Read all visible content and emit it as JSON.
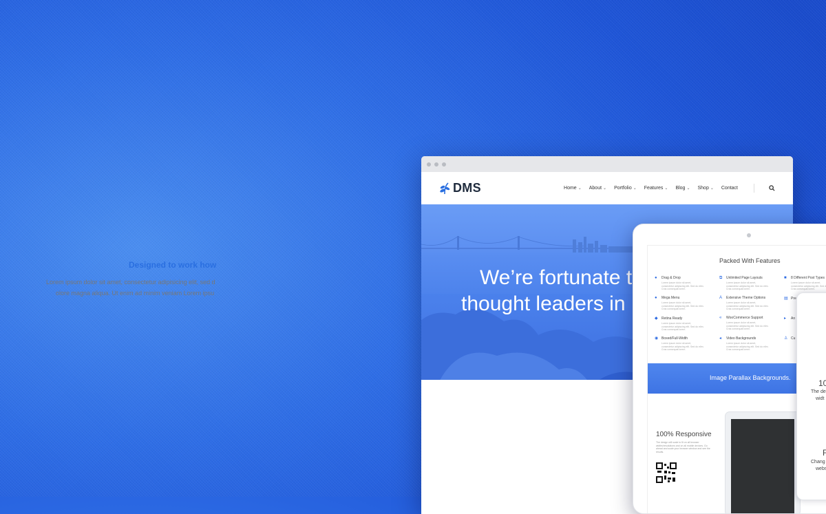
{
  "colors": {
    "accent": "#2a6fe0",
    "background": "#2f6ee6",
    "dark_text": "#1f2b3d"
  },
  "site": {
    "logo_text": "DMS",
    "logo_icon": "leaf-icon",
    "menu": [
      {
        "label": "Home",
        "has_dropdown": true
      },
      {
        "label": "About",
        "has_dropdown": true
      },
      {
        "label": "Portfolio",
        "has_dropdown": true
      },
      {
        "label": "Features",
        "has_dropdown": true
      },
      {
        "label": "Blog",
        "has_dropdown": true
      },
      {
        "label": "Shop",
        "has_dropdown": true
      },
      {
        "label": "Contact",
        "has_dropdown": false
      }
    ],
    "search_icon": "search-icon"
  },
  "hero": {
    "line1": "We’re fortunate t",
    "line2": "thought leaders in"
  },
  "section": {
    "heading": "Designed to work how",
    "lorem1": "Lorem ipsum dolor sit amet, consectetur adipisicing elit, sed d",
    "lorem2": "olore magna aliqua. Ut enim ad minim veniam Lorem ipsu"
  },
  "tablet": {
    "features_title": "Packed With Features",
    "features": [
      {
        "label": "Drag & Drop",
        "icon": "user-icon"
      },
      {
        "label": "Unlimited Page Layouts",
        "icon": "layout-icon"
      },
      {
        "label": "8 Different Post Types",
        "icon": "phone-icon"
      },
      {
        "label": "Mega Menu",
        "icon": "user-icon"
      },
      {
        "label": "Extensive Theme Options",
        "icon": "font-icon"
      },
      {
        "label": "Pre",
        "icon": "grid-icon"
      },
      {
        "label": "Retina Ready",
        "icon": "diamond-icon"
      },
      {
        "label": "WooCommerce Support",
        "icon": "cart-icon"
      },
      {
        "label": "An",
        "icon": "play-icon"
      },
      {
        "label": "Boxed/Full-Width",
        "icon": "circle-icon"
      },
      {
        "label": "Video Backgrounds",
        "icon": "video-icon"
      },
      {
        "label": "Cu",
        "icon": "person-icon"
      }
    ],
    "feature_desc": "Lorem ipsum dolor sit amet, consectetur adipiscing elit. Sed do elim. Cras consequat lorem.",
    "parallax_text": "Image Parallax Backgrounds.",
    "responsive_title": "100% Responsive",
    "responsive_desc": "The design will scale to fit on all browser widths/resolutions and on all mobile devices. Go ahead and scale your browser window and see the results."
  },
  "phone": {
    "text1": "10",
    "text2": "The de",
    "text3": "widt",
    "text4": "F",
    "text5": "Chang",
    "text6": "webs"
  }
}
